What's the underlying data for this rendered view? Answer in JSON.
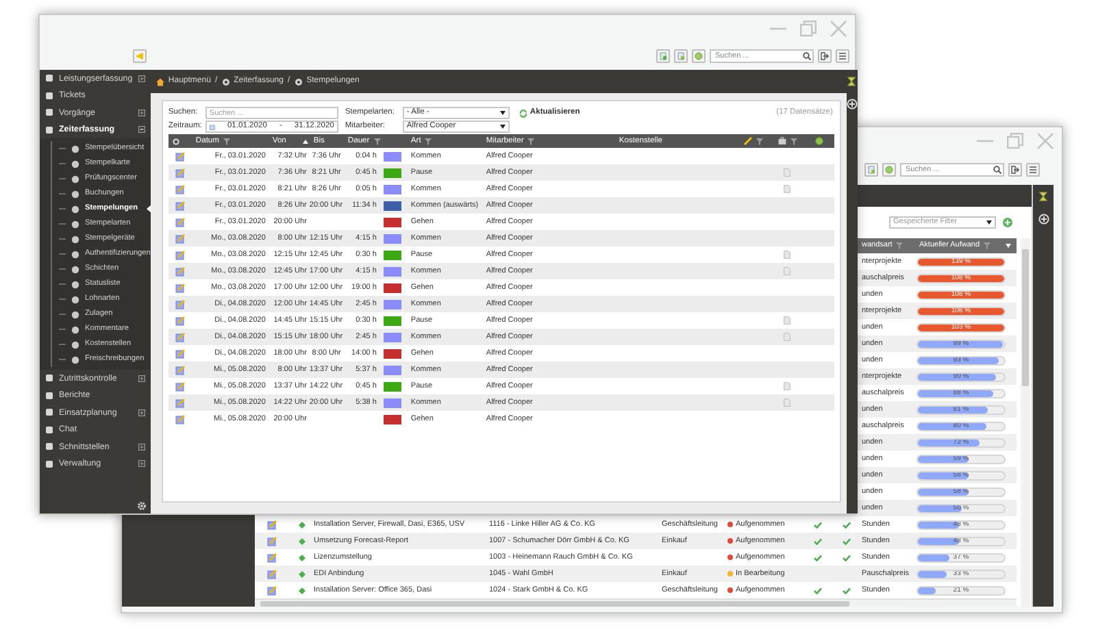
{
  "back_window": {
    "toolbar": {
      "search": {
        "placeholder": "Suchen ..."
      }
    },
    "saved_filter": {
      "placeholder": "Gespeicherte Filter"
    },
    "table": {
      "columns": [
        {
          "label": "wandsart",
          "filter": true,
          "sorted": false
        },
        {
          "label": "Aktueller Aufwand",
          "filter": true,
          "sorted": true
        }
      ],
      "rows": [
        {
          "type": "nterprojekte",
          "progress": {
            "label": "139 %",
            "level": 1,
            "color": "#e8582f"
          }
        },
        {
          "type": "auschalpreis",
          "progress": {
            "label": "108 %",
            "level": 1,
            "color": "#e8582f"
          }
        },
        {
          "type": "unden",
          "progress": {
            "label": "108 %",
            "level": 1,
            "color": "#e8582f"
          }
        },
        {
          "type": "nterprojekte",
          "progress": {
            "label": "106 %",
            "level": 1,
            "color": "#e8582f"
          }
        },
        {
          "type": "unden",
          "progress": {
            "label": "103 %",
            "level": 1,
            "color": "#e8582f"
          }
        },
        {
          "type": "unden",
          "progress": {
            "label": "99 %",
            "level": 0.99,
            "color": "#8fa8f7"
          }
        },
        {
          "type": "unden",
          "progress": {
            "label": "93 %",
            "level": 0.93,
            "color": "#8fa8f7"
          }
        },
        {
          "type": "nterprojekte",
          "progress": {
            "label": "90 %",
            "level": 0.9,
            "color": "#8fa8f7"
          }
        },
        {
          "type": "auschalpreis",
          "progress": {
            "label": "88 %",
            "level": 0.88,
            "color": "#8fa8f7"
          }
        },
        {
          "type": "unden",
          "progress": {
            "label": "81 %",
            "level": 0.81,
            "color": "#8fa8f7"
          }
        },
        {
          "type": "auschalpreis",
          "progress": {
            "label": "80 %",
            "level": 0.8,
            "color": "#8fa8f7"
          }
        },
        {
          "type": "unden",
          "progress": {
            "label": "72 %",
            "level": 0.72,
            "color": "#8fa8f7"
          }
        },
        {
          "type": "unden",
          "progress": {
            "label": "59 %",
            "level": 0.59,
            "color": "#8fa8f7"
          }
        },
        {
          "type": "unden",
          "progress": {
            "label": "58 %",
            "level": 0.58,
            "color": "#8fa8f7"
          }
        },
        {
          "type": "unden",
          "progress": {
            "label": "58 %",
            "level": 0.58,
            "color": "#8fa8f7"
          }
        },
        {
          "type": "unden",
          "progress": {
            "label": "50 %",
            "level": 0.5,
            "color": "#8fa8f7"
          }
        },
        {
          "title": "Installation Server, Firewall, Dasi, E365, USV",
          "customer": "1116 - Linke Hiller AG & Co. KG",
          "department": "Geschäftsleitung",
          "status": {
            "label": "Aufgenommen",
            "color": "#e04a3a"
          },
          "checked_1": true,
          "checked_2": true,
          "type": "Stunden",
          "progress": {
            "label": "48 %",
            "level": 0.48,
            "color": "#8fa8f7"
          }
        },
        {
          "title": "Umsetzung Forecast-Report",
          "customer": "1007 - Schumacher Dörr GmbH & Co. KG",
          "department": "Einkauf",
          "status": {
            "label": "Aufgenommen",
            "color": "#e04a3a"
          },
          "checked_1": true,
          "checked_2": true,
          "type": "Stunden",
          "progress": {
            "label": "48 %",
            "level": 0.48,
            "color": "#8fa8f7"
          }
        },
        {
          "title": "Lizenzumstellung",
          "customer": "1003 - Heinemann Rauch GmbH & Co. KG",
          "status": {
            "label": "Aufgenommen",
            "color": "#e04a3a"
          },
          "checked_1": true,
          "checked_2": true,
          "type": "Stunden",
          "progress": {
            "label": "37 %",
            "level": 0.37,
            "color": "#8fa8f7"
          }
        },
        {
          "title": "EDI Anbindung",
          "customer": "1045 - Wahl GmbH",
          "department": "Einkauf",
          "status": {
            "label": "In Bearbeitung",
            "color": "#f0b428"
          },
          "checked_1": false,
          "checked_2": false,
          "type": "Pauschalpreis",
          "progress": {
            "label": "33 %",
            "level": 0.33,
            "color": "#8fa8f7"
          }
        },
        {
          "title": "Installation Server: Office 365, Dasi",
          "customer": "1024 - Stark GmbH & Co. KG",
          "department": "Geschäftsleitung",
          "status": {
            "label": "Aufgenommen",
            "color": "#e04a3a"
          },
          "checked_1": true,
          "checked_2": true,
          "type": "Stunden",
          "progress": {
            "label": "21 %",
            "level": 0.21,
            "color": "#8fa8f7"
          }
        }
      ]
    }
  },
  "front_window": {
    "toolbar": {
      "search": {
        "placeholder": "Suchen ..."
      }
    },
    "sidebar": {
      "items": [
        {
          "label": "Leistungserfassung",
          "selected": false,
          "expanded": false
        },
        {
          "label": "Tickets",
          "selected": false
        },
        {
          "label": "Vorgänge",
          "selected": false,
          "expanded": false
        },
        {
          "label": "Zeiterfassung",
          "selected": false,
          "expanded": true,
          "children": [
            {
              "label": "Stempelübersicht",
              "selected": false
            },
            {
              "label": "Stempelkarte",
              "selected": false
            },
            {
              "label": "Prüfungscenter",
              "selected": false
            },
            {
              "label": "Buchungen",
              "selected": false
            },
            {
              "label": "Stempelungen",
              "selected": true
            },
            {
              "label": "Stempelarten",
              "selected": false
            },
            {
              "label": "Stempelgeräte",
              "selected": false
            },
            {
              "label": "Authentifizierungen",
              "selected": false
            },
            {
              "label": "Schichten",
              "selected": false
            },
            {
              "label": "Statusliste",
              "selected": false
            },
            {
              "label": "Lohnarten",
              "selected": false
            },
            {
              "label": "Zulagen",
              "selected": false
            },
            {
              "label": "Kommentare",
              "selected": false
            },
            {
              "label": "Kostenstellen",
              "selected": false
            },
            {
              "label": "Freischreibungen",
              "selected": false
            }
          ]
        },
        {
          "label": "Zutrittskontrolle",
          "selected": false,
          "expanded": false
        },
        {
          "label": "Berichte",
          "selected": false
        },
        {
          "label": "Einsatzplanung",
          "selected": false,
          "expanded": false
        },
        {
          "label": "Chat",
          "selected": false
        },
        {
          "label": "Schnittstellen",
          "selected": false,
          "expanded": false
        },
        {
          "label": "Verwaltung",
          "selected": false,
          "expanded": false
        }
      ]
    },
    "breadcrumb": {
      "items": [
        "Hauptmenü",
        "Zeiterfassung",
        "Stempelungen"
      ],
      "separator": "/"
    },
    "filters": {
      "search": {
        "label": "Suchen:",
        "placeholder": "Suchen ..."
      },
      "period": {
        "label": "Zeitraum:",
        "from": "01.01.2020",
        "separator": "-",
        "to": "31.12.2020"
      },
      "stamp_types": {
        "label": "Stempelarten:",
        "value": "- Alle -"
      },
      "employee": {
        "label": "Mitarbeiter:",
        "value": "Alfred Cooper"
      },
      "refresh_button": "Aktualisieren",
      "record_count": "(17 Datensätze)"
    },
    "table": {
      "columns": [
        {
          "kind": "gear"
        },
        {
          "kind": "text",
          "label": "Datum",
          "filter": true
        },
        {
          "kind": "text",
          "label": "Von",
          "filter": false,
          "sorted": true
        },
        {
          "kind": "text",
          "label": "Bis",
          "filter": false
        },
        {
          "kind": "text",
          "label": "Dauer",
          "filter": true
        },
        {
          "kind": "blank"
        },
        {
          "kind": "text",
          "label": "Art",
          "filter": true
        },
        {
          "kind": "text",
          "label": "Mitarbeiter",
          "filter": true
        },
        {
          "kind": "text",
          "label": "Kostenstelle",
          "filter": false
        },
        {
          "kind": "pencil",
          "filter": true
        },
        {
          "kind": "briefcase",
          "filter": true
        },
        {
          "kind": "globe"
        }
      ],
      "rows": [
        {
          "date": "Fr., 03.01.2020",
          "from": "7:32 Uhr",
          "to": "7:36 Uhr",
          "duration": "0:04 h",
          "color": "#8c8cf8",
          "type": "Kommen",
          "employee": "Alfred Cooper",
          "attachment": false
        },
        {
          "date": "Fr., 03.01.2020",
          "from": "7:36 Uhr",
          "to": "8:21 Uhr",
          "duration": "0:45 h",
          "color": "#3ca914",
          "type": "Pause",
          "employee": "Alfred Cooper",
          "attachment": true
        },
        {
          "date": "Fr., 03.01.2020",
          "from": "8:21 Uhr",
          "to": "8:26 Uhr",
          "duration": "0:05 h",
          "color": "#8c8cf8",
          "type": "Kommen",
          "employee": "Alfred Cooper",
          "attachment": true
        },
        {
          "date": "Fr., 03.01.2020",
          "from": "8:26 Uhr",
          "to": "20:00 Uhr",
          "duration": "11:34 h",
          "color": "#3f5fa8",
          "type": "Kommen (auswärts)",
          "employee": "Alfred Cooper",
          "attachment": false
        },
        {
          "date": "Fr., 03.01.2020",
          "from": "20:00 Uhr",
          "color": "#c42f2f",
          "type": "Gehen",
          "employee": "Alfred Cooper",
          "attachment": false
        },
        {
          "date": "Mo., 03.08.2020",
          "from": "8:00 Uhr",
          "to": "12:15 Uhr",
          "duration": "4:15 h",
          "color": "#8c8cf8",
          "type": "Kommen",
          "employee": "Alfred Cooper",
          "attachment": false
        },
        {
          "date": "Mo., 03.08.2020",
          "from": "12:15 Uhr",
          "to": "12:45 Uhr",
          "duration": "0:30 h",
          "color": "#3ca914",
          "type": "Pause",
          "employee": "Alfred Cooper",
          "attachment": true
        },
        {
          "date": "Mo., 03.08.2020",
          "from": "12:45 Uhr",
          "to": "17:00 Uhr",
          "duration": "4:15 h",
          "color": "#8c8cf8",
          "type": "Kommen",
          "employee": "Alfred Cooper",
          "attachment": true
        },
        {
          "date": "Mo., 03.08.2020",
          "from": "17:00 Uhr",
          "to": "12:00 Uhr",
          "duration": "19:00 h",
          "color": "#c42f2f",
          "type": "Gehen",
          "employee": "Alfred Cooper",
          "attachment": false
        },
        {
          "date": "Di., 04.08.2020",
          "from": "12:00 Uhr",
          "to": "14:45 Uhr",
          "duration": "2:45 h",
          "color": "#8c8cf8",
          "type": "Kommen",
          "employee": "Alfred Cooper",
          "attachment": false
        },
        {
          "date": "Di., 04.08.2020",
          "from": "14:45 Uhr",
          "to": "15:15 Uhr",
          "duration": "0:30 h",
          "color": "#3ca914",
          "type": "Pause",
          "employee": "Alfred Cooper",
          "attachment": true
        },
        {
          "date": "Di., 04.08.2020",
          "from": "15:15 Uhr",
          "to": "18:00 Uhr",
          "duration": "2:45 h",
          "color": "#8c8cf8",
          "type": "Kommen",
          "employee": "Alfred Cooper",
          "attachment": true
        },
        {
          "date": "Di., 04.08.2020",
          "from": "18:00 Uhr",
          "to": "8:00 Uhr",
          "duration": "14:00 h",
          "color": "#c42f2f",
          "type": "Gehen",
          "employee": "Alfred Cooper",
          "attachment": false
        },
        {
          "date": "Mi., 05.08.2020",
          "from": "8:00 Uhr",
          "to": "13:37 Uhr",
          "duration": "5:37 h",
          "color": "#8c8cf8",
          "type": "Kommen",
          "employee": "Alfred Cooper",
          "attachment": false
        },
        {
          "date": "Mi., 05.08.2020",
          "from": "13:37 Uhr",
          "to": "14:22 Uhr",
          "duration": "0:45 h",
          "color": "#3ca914",
          "type": "Pause",
          "employee": "Alfred Cooper",
          "attachment": true
        },
        {
          "date": "Mi., 05.08.2020",
          "from": "14:22 Uhr",
          "to": "20:00 Uhr",
          "duration": "5:38 h",
          "color": "#8c8cf8",
          "type": "Kommen",
          "employee": "Alfred Cooper",
          "attachment": true
        },
        {
          "date": "Mi., 05.08.2020",
          "from": "20:00 Uhr",
          "color": "#c42f2f",
          "type": "Gehen",
          "employee": "Alfred Cooper",
          "attachment": false
        }
      ]
    }
  }
}
